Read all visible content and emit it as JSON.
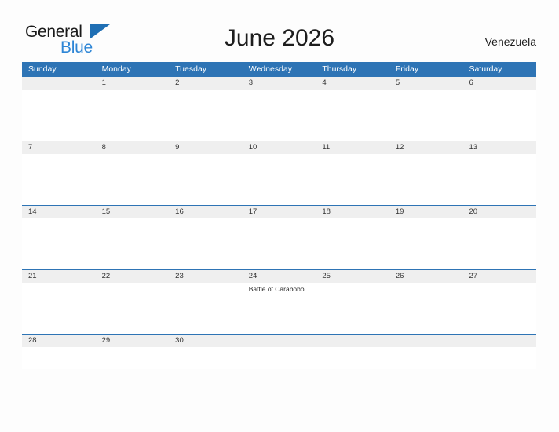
{
  "brand": {
    "name_part1": "General",
    "name_part2": "Blue",
    "triangle_icon": "blue-triangle-logo-mark",
    "colors": {
      "dark_text": "#1a1a1a",
      "blue_text": "#2e86d6",
      "triangle": "#1f6fb4"
    }
  },
  "header": {
    "title": "June 2026",
    "country": "Venezuela"
  },
  "calendar": {
    "month": "June",
    "year": "2026",
    "weekday_headers": [
      "Sunday",
      "Monday",
      "Tuesday",
      "Wednesday",
      "Thursday",
      "Friday",
      "Saturday"
    ],
    "colors": {
      "header_blue": "#2e74b5",
      "date_band_gray": "#efefef",
      "cell_white": "#ffffff",
      "page_background": "#fdfdfd"
    },
    "weeks": [
      {
        "days": [
          {
            "num": "",
            "event": ""
          },
          {
            "num": "1",
            "event": ""
          },
          {
            "num": "2",
            "event": ""
          },
          {
            "num": "3",
            "event": ""
          },
          {
            "num": "4",
            "event": ""
          },
          {
            "num": "5",
            "event": ""
          },
          {
            "num": "6",
            "event": ""
          }
        ]
      },
      {
        "days": [
          {
            "num": "7",
            "event": ""
          },
          {
            "num": "8",
            "event": ""
          },
          {
            "num": "9",
            "event": ""
          },
          {
            "num": "10",
            "event": ""
          },
          {
            "num": "11",
            "event": ""
          },
          {
            "num": "12",
            "event": ""
          },
          {
            "num": "13",
            "event": ""
          }
        ]
      },
      {
        "days": [
          {
            "num": "14",
            "event": ""
          },
          {
            "num": "15",
            "event": ""
          },
          {
            "num": "16",
            "event": ""
          },
          {
            "num": "17",
            "event": ""
          },
          {
            "num": "18",
            "event": ""
          },
          {
            "num": "19",
            "event": ""
          },
          {
            "num": "20",
            "event": ""
          }
        ]
      },
      {
        "days": [
          {
            "num": "21",
            "event": ""
          },
          {
            "num": "22",
            "event": ""
          },
          {
            "num": "23",
            "event": ""
          },
          {
            "num": "24",
            "event": "Battle of Carabobo"
          },
          {
            "num": "25",
            "event": ""
          },
          {
            "num": "26",
            "event": ""
          },
          {
            "num": "27",
            "event": ""
          }
        ]
      },
      {
        "days": [
          {
            "num": "28",
            "event": ""
          },
          {
            "num": "29",
            "event": ""
          },
          {
            "num": "30",
            "event": ""
          },
          {
            "num": "",
            "event": ""
          },
          {
            "num": "",
            "event": ""
          },
          {
            "num": "",
            "event": ""
          },
          {
            "num": "",
            "event": ""
          }
        ]
      }
    ]
  }
}
